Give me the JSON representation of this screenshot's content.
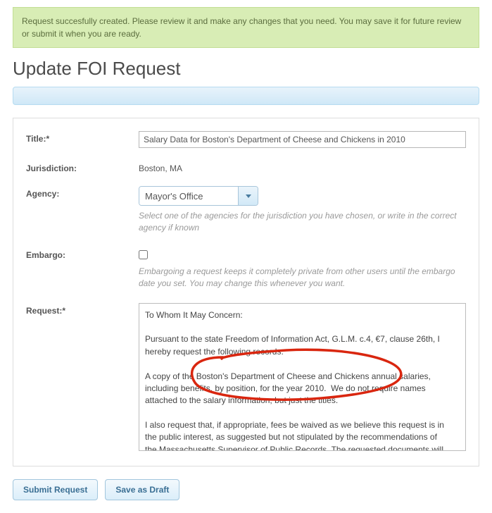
{
  "notice": "Request succesfully created. Please review it and make any changes that you need. You may save it for future review or submit it when you are ready.",
  "page_title": "Update FOI Request",
  "form": {
    "title": {
      "label": "Title:*",
      "value": "Salary Data for Boston's Department of Cheese and Chickens in 2010"
    },
    "jurisdiction": {
      "label": "Jurisdiction:",
      "value": "Boston, MA"
    },
    "agency": {
      "label": "Agency:",
      "value": "Mayor's Office",
      "helper": "Select one of the agencies for the jurisdiction you have chosen, or write in the correct agency if known"
    },
    "embargo": {
      "label": "Embargo:",
      "checked": false,
      "helper": "Embargoing a request keeps it completely private from other users until the embargo date you set. You may change this whenever you want."
    },
    "request": {
      "label": "Request:*",
      "value": "To Whom It May Concern:\n\nPursuant to the state Freedom of Information Act, G.L.M. c.4, €7, clause 26th, I hereby request the following records:\n\nA copy of the Boston's Department of Cheese and Chickens annual salaries, including benefits, by position, for the year 2010.  We do not require names attached to the salary information, but just the titles.\n\nI also request that, if appropriate, fees be waived as we believe this request is in the public interest, as suggested but not stipulated by the recommendations of the Massachusetts Supervisor of Public Records. The requested documents will be made available to the general public free of charge as part of the public information service at MuckRock.com, processed by a representative of the"
    }
  },
  "buttons": {
    "submit": "Submit Request",
    "draft": "Save as Draft"
  },
  "annotation": {
    "type": "red-circle",
    "description": "hand-drawn red irregular circle highlighting text in request body"
  }
}
